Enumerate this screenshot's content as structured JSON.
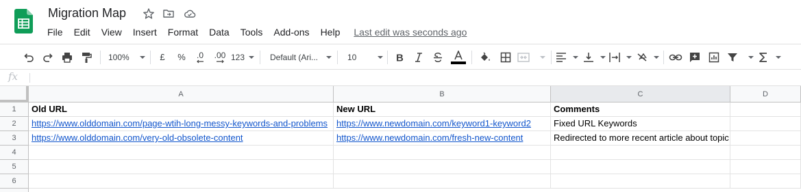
{
  "document": {
    "title": "Migration Map",
    "last_edit": "Last edit was seconds ago"
  },
  "menu": {
    "items": [
      "File",
      "Edit",
      "View",
      "Insert",
      "Format",
      "Data",
      "Tools",
      "Add-ons",
      "Help"
    ]
  },
  "toolbar": {
    "zoom": "100%",
    "currency": "£",
    "percent": "%",
    "decrease_decimal": ".0",
    "increase_decimal": ".00",
    "more_formats": "123",
    "font_family": "Default (Ari...",
    "font_size": "10",
    "text_color_bar": "#000000"
  },
  "formula_bar": {
    "label": "fx",
    "value": ""
  },
  "grid": {
    "columns": [
      "A",
      "B",
      "C",
      "D"
    ],
    "selected_column": "C",
    "row_numbers": [
      "1",
      "2",
      "3",
      "4",
      "5",
      "6"
    ],
    "rows": [
      [
        "Old URL",
        "New URL",
        "Comments",
        ""
      ],
      [
        "https://www.olddomain.com/page-wtih-long-messy-keywords-and-problems",
        "https://www.newdomain.com/keyword1-keyword2",
        "Fixed URL Keywords",
        ""
      ],
      [
        "https://www.olddomain.com/very-old-obsolete-content",
        "https://www.newdomain.com/fresh-new-content",
        "Redirected to more recent article about topic",
        ""
      ],
      [
        "",
        "",
        "",
        ""
      ],
      [
        "",
        "",
        "",
        ""
      ],
      [
        "",
        "",
        "",
        ""
      ]
    ]
  },
  "colors": {
    "logo_green": "#0f9d58",
    "link_blue": "#1155cc",
    "header_bg": "#f8f9fa"
  }
}
